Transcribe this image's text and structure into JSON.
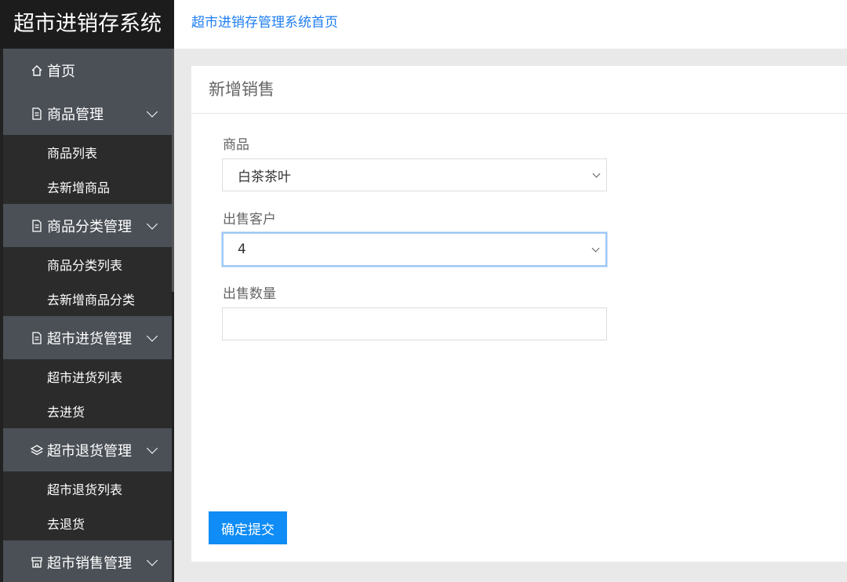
{
  "app": {
    "brand": "超市进销存系统",
    "home_link": "超市进销存管理系统首页"
  },
  "sidebar": {
    "home": "首页",
    "product": {
      "label": "商品管理",
      "sub": [
        "商品列表",
        "去新增商品"
      ]
    },
    "category": {
      "label": "商品分类管理",
      "sub": [
        "商品分类列表",
        "去新增商品分类"
      ]
    },
    "purchase": {
      "label": "超市进货管理",
      "sub": [
        "超市进货列表",
        "去进货"
      ]
    },
    "returns": {
      "label": "超市退货管理",
      "sub": [
        "超市退货列表",
        "去退货"
      ]
    },
    "sales": {
      "label": "超市销售管理"
    }
  },
  "form": {
    "title": "新增销售",
    "product_label": "商品",
    "product_value": "白茶茶叶",
    "customer_label": "出售客户",
    "customer_value": "4",
    "quantity_label": "出售数量",
    "quantity_value": "",
    "submit": "确定提交"
  },
  "colors": {
    "accent": "#0f8cf5",
    "link": "#1e7ef0",
    "sidebar": "#222222",
    "menu_group": "#4b5057"
  }
}
